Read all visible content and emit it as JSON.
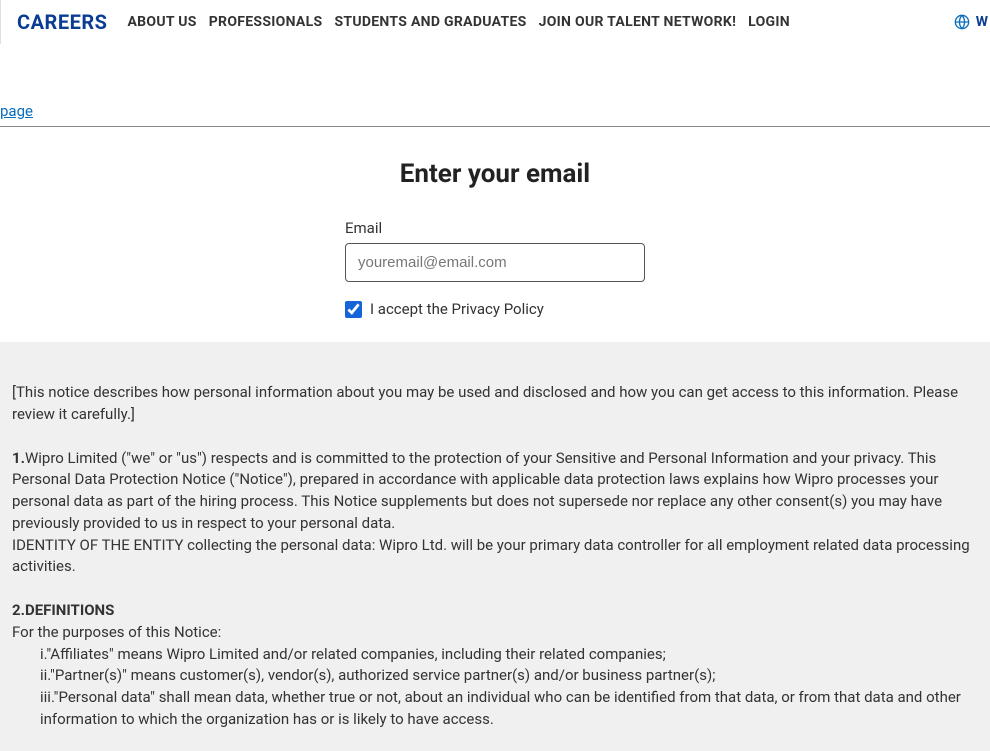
{
  "nav": {
    "brand": "CAREERS",
    "items": [
      "ABOUT US",
      "PROFESSIONALS",
      "STUDENTS AND GRADUATES",
      "JOIN OUR TALENT NETWORK!",
      "LOGIN"
    ],
    "right_label": "W"
  },
  "page_link": "page",
  "heading": "Enter your email",
  "form": {
    "email_label": "Email",
    "email_placeholder": "youremail@email.com",
    "accept_label": "I accept the Privacy Policy"
  },
  "notice": {
    "intro": "[This notice describes how personal information about you may be used and disclosed and how you can get access to this information. Please review it carefully.]",
    "p1_num": "1.",
    "p1_body": "Wipro Limited (\"we\" or \"us\") respects and is committed to the protection of your Sensitive and Personal Information and your privacy. This Personal Data Protection Notice (\"Notice\"), prepared in accordance with applicable data protection laws explains how Wipro processes your personal data as part of the hiring process. This Notice supplements but does not supersede nor replace any other consent(s) you may have previously provided to us in respect to your personal data.",
    "p1_identity": "IDENTITY OF THE ENTITY collecting the personal data: Wipro Ltd. will be your primary data controller for all employment related data processing activities.",
    "p2_num": "2.",
    "p2_heading": "DEFINITIONS",
    "p2_intro": "For the purposes of this Notice:",
    "defs": {
      "i_prefix": "i.",
      "i": "\"Affiliates\" means Wipro Limited and/or related companies, including their related companies;",
      "ii_prefix": "ii.",
      "ii": "\"Partner(s)\" means customer(s), vendor(s), authorized service partner(s) and/or business partner(s);",
      "iii_prefix": "iii.",
      "iii": "\"Personal data\" shall mean data, whether true or not, about an individual who can be identified from that data, or from that data and other information to which the organization has or is likely to have access."
    }
  }
}
